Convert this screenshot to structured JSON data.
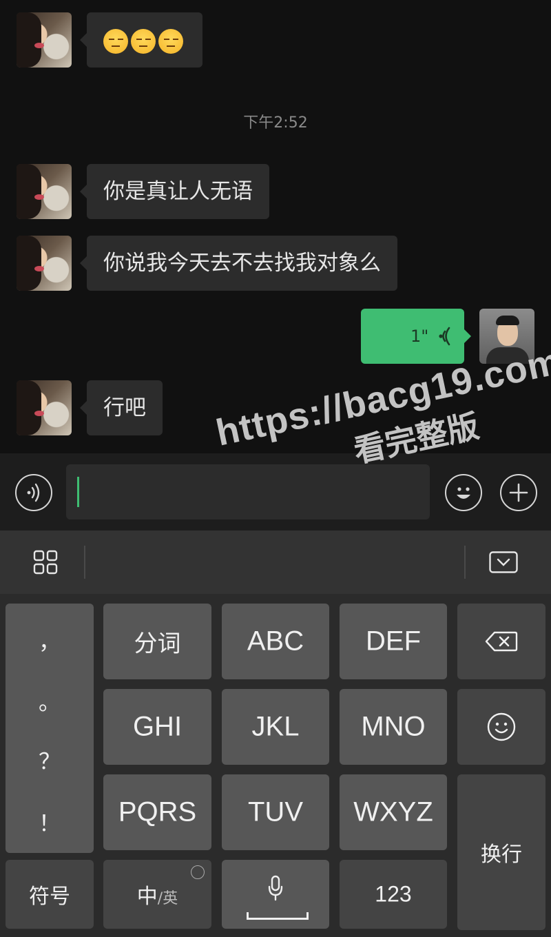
{
  "chat": {
    "messages": [
      {
        "side": "left",
        "type": "emoji",
        "emoji": [
          "unamused-face",
          "unamused-face",
          "unamused-face"
        ]
      },
      {
        "type": "timestamp",
        "text": "下午2:52"
      },
      {
        "side": "left",
        "type": "text",
        "text": "你是真让人无语"
      },
      {
        "side": "left",
        "type": "text",
        "text": "你说我今天去不去找我对象么"
      },
      {
        "side": "right",
        "type": "voice",
        "duration": "1\"",
        "icon": "voice-wave-icon"
      },
      {
        "side": "left",
        "type": "text",
        "text": "行吧"
      }
    ]
  },
  "input_bar": {
    "voice_icon": "voice-input-icon",
    "emoji_icon": "smiley-icon",
    "plus_icon": "plus-icon",
    "value": ""
  },
  "watermark": {
    "url": "https://bacg19.com",
    "text": "看完整版"
  },
  "keyboard": {
    "toolbar": {
      "menu_icon": "grid-icon",
      "hide_icon": "keyboard-hide-icon"
    },
    "punctuation": [
      "，",
      "。",
      "？",
      "！"
    ],
    "keys_row1": [
      "分词",
      "ABC",
      "DEF"
    ],
    "keys_row2": [
      "GHI",
      "JKL",
      "MNO"
    ],
    "keys_row3": [
      "PQRS",
      "TUV",
      "WXYZ"
    ],
    "backspace_icon": "backspace-icon",
    "emoji_key_icon": "smiley-icon",
    "enter_label": "换行",
    "symbols_label": "符号",
    "lang_label_main": "中",
    "lang_label_alt": "/英",
    "space_icon": "mic-icon",
    "numbers_label": "123"
  },
  "colors": {
    "background": "#111111",
    "bubble_left": "#2c2c2c",
    "bubble_right": "#3fbd72",
    "keyboard_bg": "#2b2b2b",
    "key_bg": "#575757"
  }
}
